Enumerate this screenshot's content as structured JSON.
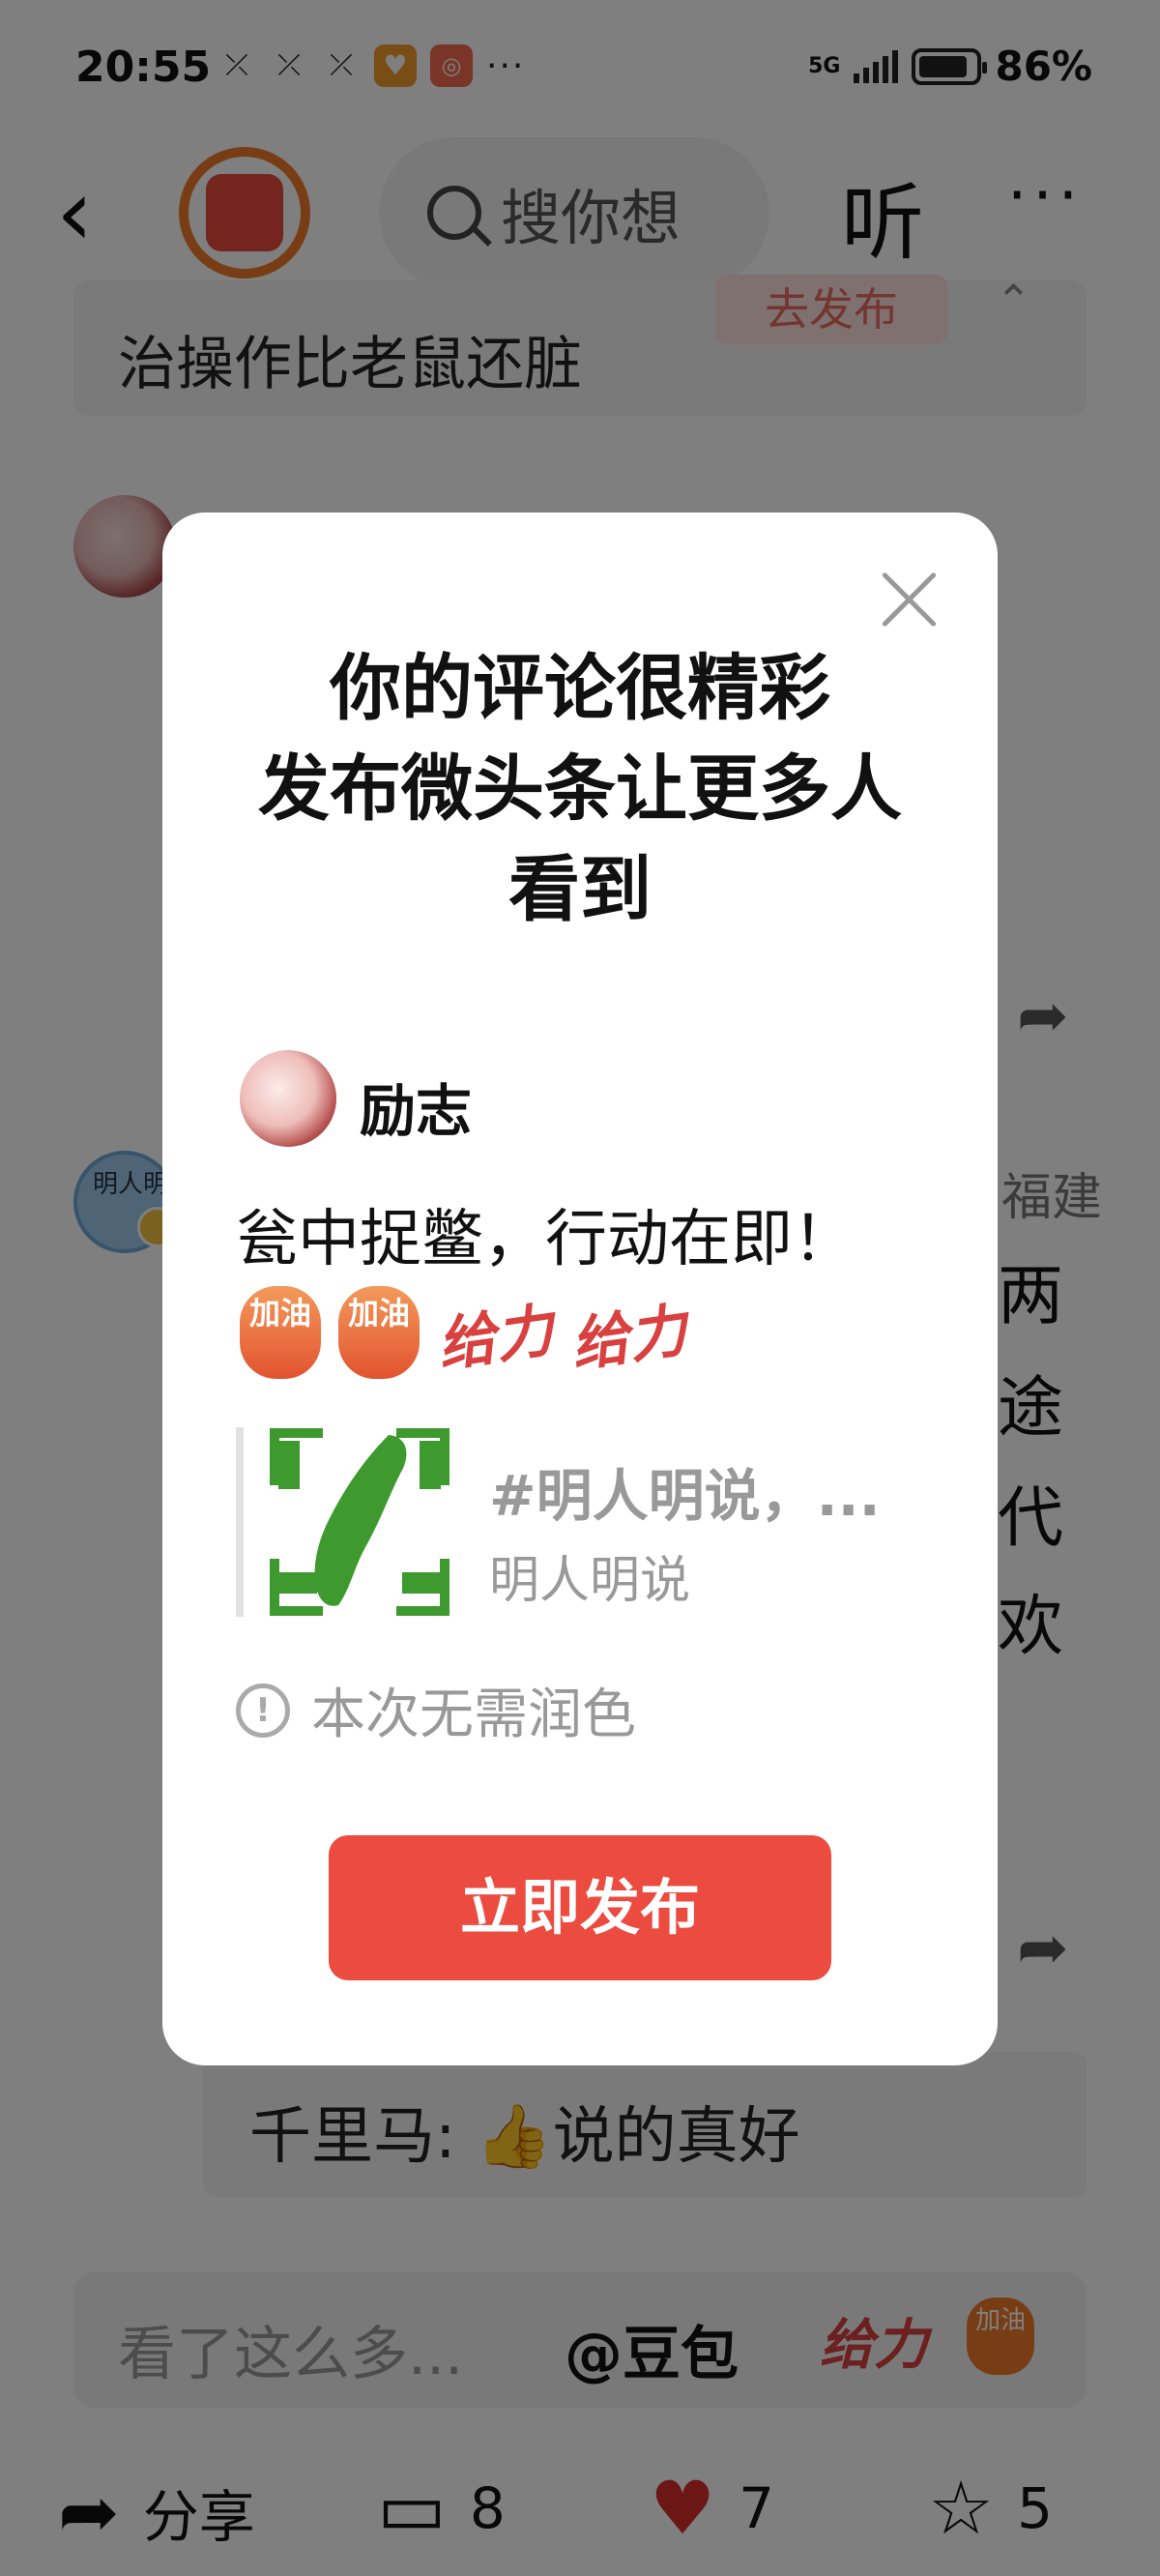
{
  "status_bar": {
    "time": "20:55",
    "network": "5G",
    "battery_pct": "86%",
    "battery_level": 0.86,
    "more": "···"
  },
  "topbar": {
    "search_placeholder": "搜你想",
    "listen_label": "听",
    "more_label": "···"
  },
  "background": {
    "card_text": "治操作比老鼠还脏",
    "card_button": "去发布",
    "avatar2_text": "明人明",
    "city_fragment": "福建",
    "side_chars": [
      "两",
      "途",
      "代",
      "欢"
    ],
    "reply_text": "千里马: 👍说的真好",
    "input_placeholder": "看了这么多...",
    "input_mention": "@豆包",
    "input_sticker1": "给力",
    "input_sticker2": "加油"
  },
  "modal": {
    "title_lines": [
      "你的评论很精彩",
      "发布微头条让更多人",
      "看到"
    ],
    "username": "励志",
    "content": "瓮中捉鳖，行动在即！",
    "stickers": [
      "加油",
      "加油",
      "给力",
      "给力"
    ],
    "link_title": "#明人明说，...",
    "link_subtitle": "明人明说",
    "hint_icon": "!",
    "hint": "本次无需润色",
    "publish_button": "立即发布"
  },
  "bottom_bar": {
    "share_label": "分享",
    "comment_count": "8",
    "like_count": "7",
    "favorite_count": "5"
  },
  "colors": {
    "accent_red": "#ec4b40",
    "like_red": "#d92c2c",
    "taiwan_green": "#3e9a2f"
  }
}
